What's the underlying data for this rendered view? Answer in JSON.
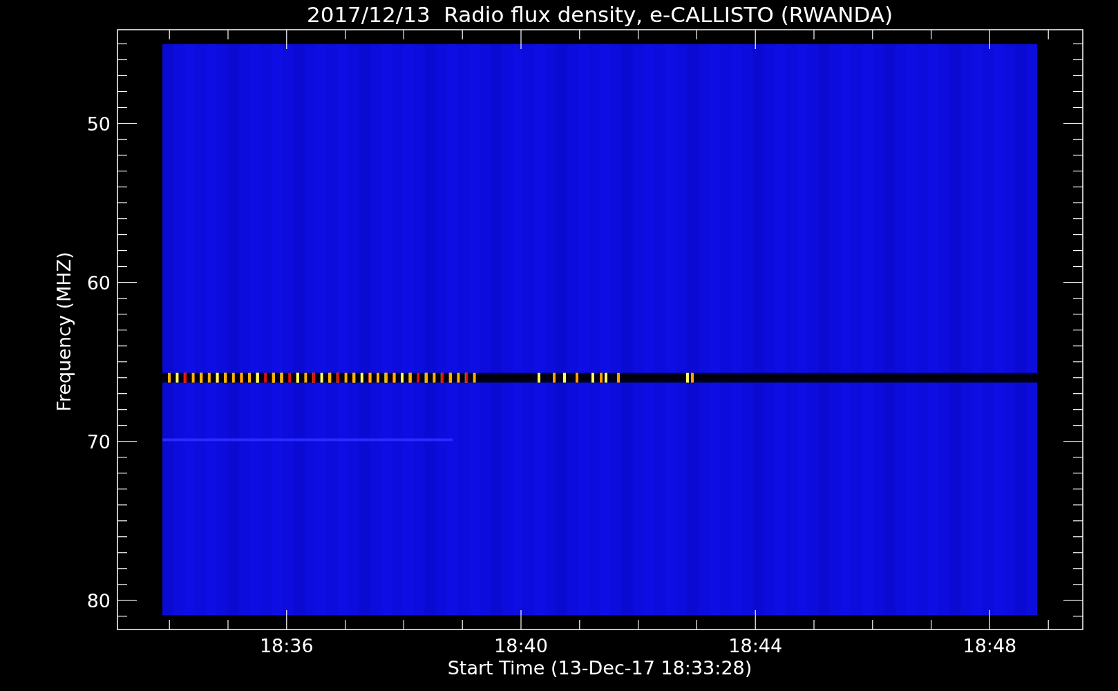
{
  "chart": {
    "title": "2017/12/13  Radio flux density, e-CALLISTO (RWANDA)",
    "ylabel": "Frequency (MHZ)",
    "xlabel": "Start Time (13-Dec-17 18:33:28)",
    "yticks": [
      "50",
      "60",
      "70",
      "80"
    ],
    "xticks": [
      "18:36",
      "18:40",
      "18:44",
      "18:48"
    ]
  }
}
